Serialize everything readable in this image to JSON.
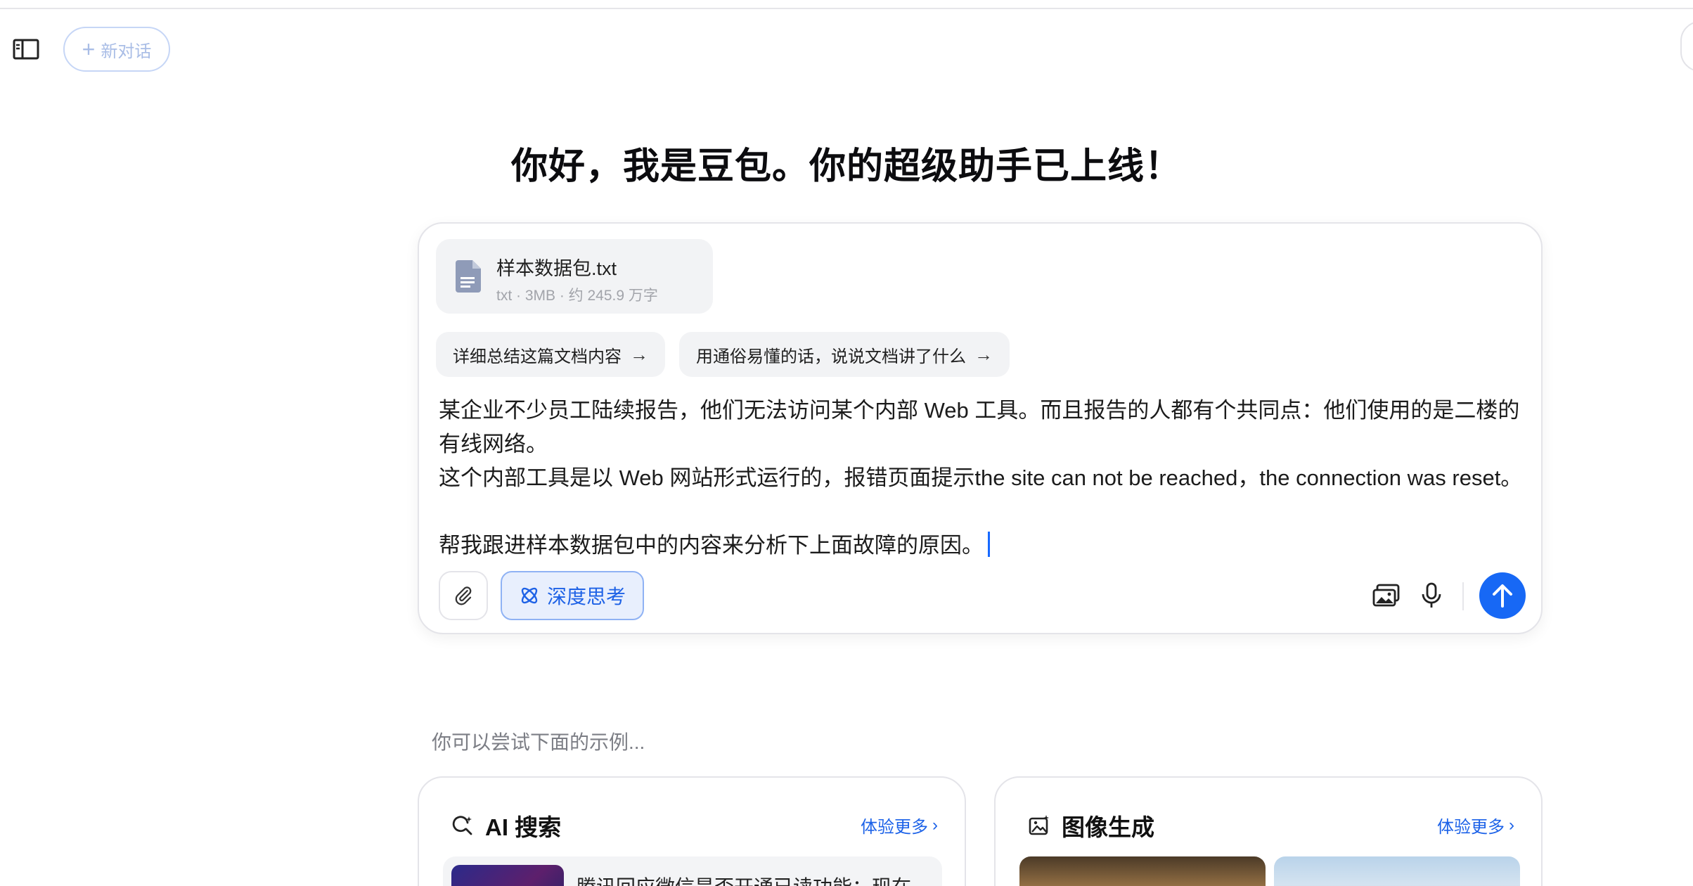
{
  "header": {
    "new_chat_label": "新对话"
  },
  "greeting": "你好，我是豆包。你的超级助手已上线！",
  "attachment": {
    "file_name": "样本数据包.txt",
    "file_meta": "txt · 3MB · 约 245.9 万字"
  },
  "suggestions": [
    {
      "label": "详细总结这篇文档内容"
    },
    {
      "label": "用通俗易懂的话，说说文档讲了什么"
    }
  ],
  "prompt": {
    "text": "某企业不少员工陆续报告，他们无法访问某个内部 Web 工具。而且报告的人都有个共同点：他们使用的是二楼的有线网络。\n这个内部工具是以 Web 网站形式运行的，报错页面提示the site can not be reached，the connection was reset。\n\n帮我跟进样本数据包中的内容来分析下上面故障的原因。"
  },
  "toolbar": {
    "deep_think_label": "深度思考"
  },
  "hint": "你可以尝试下面的示例...",
  "cards": [
    {
      "title": "AI 搜索",
      "more_label": "体验更多",
      "item_text": "腾讯回应微信是否开通已读功能：现在"
    },
    {
      "title": "图像生成",
      "more_label": "体验更多"
    }
  ],
  "colors": {
    "accent": "#1768f5",
    "deep_think_bg": "#e8effd",
    "deep_think_border": "#8fb2f4",
    "link": "#1c62e8"
  }
}
